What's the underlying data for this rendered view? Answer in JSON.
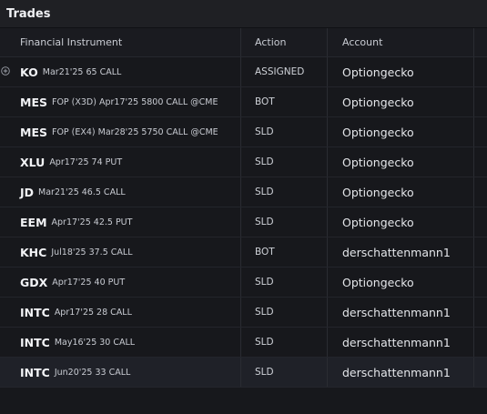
{
  "panel": {
    "title": "Trades"
  },
  "columns": {
    "instrument": "Financial Instrument",
    "action": "Action",
    "account": "Account"
  },
  "rows": [
    {
      "symbol": "KO",
      "detail": "Mar21'25 65 CALL",
      "action": "ASSIGNED",
      "account": "Optiongecko"
    },
    {
      "symbol": "MES",
      "detail": "FOP (X3D) Apr17'25 5800 CALL @CME",
      "action": "BOT",
      "account": "Optiongecko"
    },
    {
      "symbol": "MES",
      "detail": "FOP (EX4) Mar28'25 5750 CALL @CME",
      "action": "SLD",
      "account": "Optiongecko"
    },
    {
      "symbol": "XLU",
      "detail": "Apr17'25 74 PUT",
      "action": "SLD",
      "account": "Optiongecko"
    },
    {
      "symbol": "JD",
      "detail": "Mar21'25 46.5 CALL",
      "action": "SLD",
      "account": "Optiongecko"
    },
    {
      "symbol": "EEM",
      "detail": "Apr17'25 42.5 PUT",
      "action": "SLD",
      "account": "Optiongecko"
    },
    {
      "symbol": "KHC",
      "detail": "Jul18'25 37.5 CALL",
      "action": "BOT",
      "account": "derschattenmann1"
    },
    {
      "symbol": "GDX",
      "detail": "Apr17'25 40 PUT",
      "action": "SLD",
      "account": "Optiongecko"
    },
    {
      "symbol": "INTC",
      "detail": "Apr17'25 28 CALL",
      "action": "SLD",
      "account": "derschattenmann1"
    },
    {
      "symbol": "INTC",
      "detail": "May16'25 30 CALL",
      "action": "SLD",
      "account": "derschattenmann1"
    },
    {
      "symbol": "INTC",
      "detail": "Jun20'25 33 CALL",
      "action": "SLD",
      "account": "derschattenmann1"
    }
  ],
  "icons": {
    "expand": "plus-circle-icon"
  }
}
